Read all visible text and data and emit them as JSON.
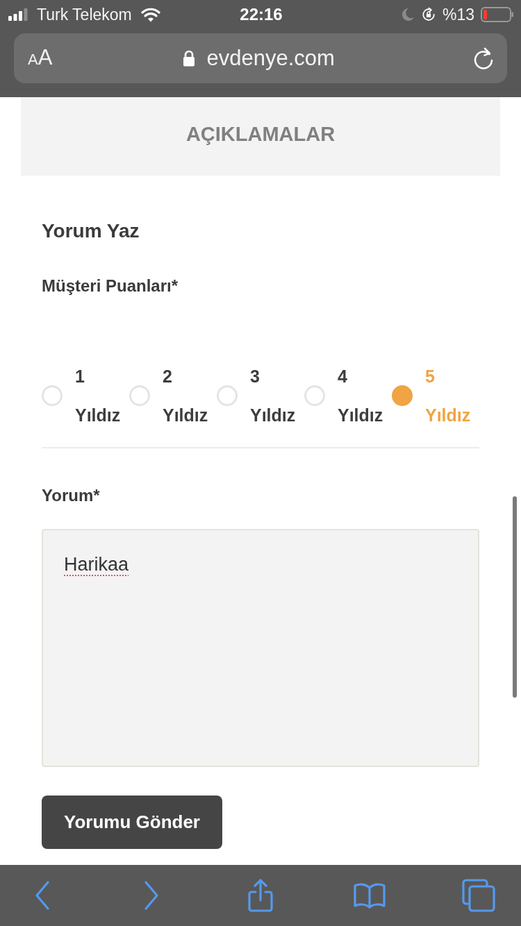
{
  "status_bar": {
    "carrier": "Turk Telekom",
    "time": "22:16",
    "battery_percent": "%13"
  },
  "address_bar": {
    "text_size_button": "AA",
    "url": "evdenye.com"
  },
  "panel": {
    "title": "AÇIKLAMALAR"
  },
  "review_form": {
    "heading": "Yorum Yaz",
    "rating_label": "Müşteri Puanları*",
    "ratings": [
      {
        "label": "1 Yıldız",
        "selected": false
      },
      {
        "label": "2 Yıldız",
        "selected": false
      },
      {
        "label": "3 Yıldız",
        "selected": false
      },
      {
        "label": "4 Yıldız",
        "selected": false
      },
      {
        "label": "5 Yıldız",
        "selected": true
      }
    ],
    "comment_label": "Yorum*",
    "comment": {
      "value": "Harikaa"
    },
    "submit_button": "Yorumu Gönder"
  }
}
